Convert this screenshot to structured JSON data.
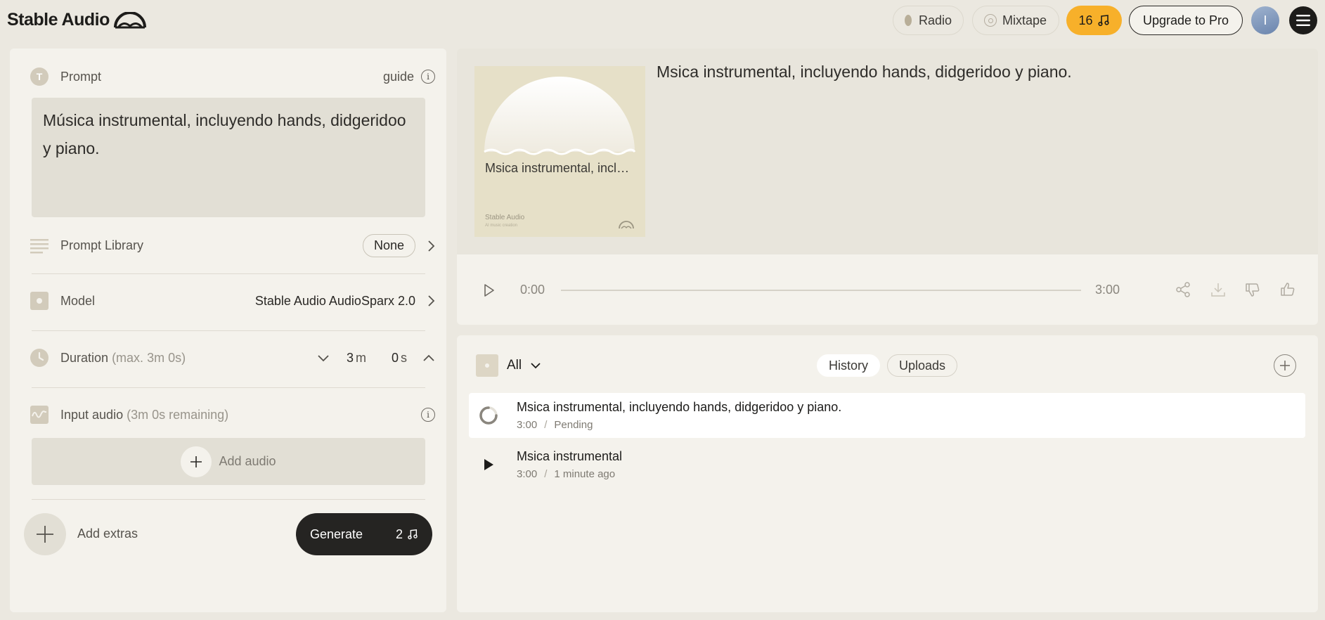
{
  "header": {
    "brand": "Stable Audio",
    "radio_label": "Radio",
    "mixtape_label": "Mixtape",
    "credits": "16",
    "upgrade_label": "Upgrade to Pro",
    "avatar_initial": "I"
  },
  "prompt_panel": {
    "prompt_label": "Prompt",
    "guide_label": "guide",
    "prompt_text": "Música instrumental, incluyendo hands, didgeridoo y piano.",
    "library_label": "Prompt Library",
    "library_value": "None",
    "model_label": "Model",
    "model_value": "Stable Audio AudioSparx 2.0",
    "duration_label": "Duration",
    "duration_hint": "(max. 3m 0s)",
    "duration_minutes": "3",
    "duration_minutes_unit": "m",
    "duration_seconds": "0",
    "duration_seconds_unit": "s",
    "input_audio_label": "Input audio",
    "input_audio_hint": "(3m 0s remaining)",
    "add_audio_label": "Add audio",
    "add_extras_label": "Add extras",
    "generate_label": "Generate",
    "generate_cost": "2"
  },
  "player": {
    "cover_title": "Msica instrumental, incluyendo hands, didgeridoo y piano.",
    "cover_brand": "Stable Audio",
    "cover_sub": "AI music creation",
    "track_title": "Msica instrumental, incluyendo hands, didgeridoo y piano.",
    "time_current": "0:00",
    "time_total": "3:00",
    "progress": 0
  },
  "library": {
    "filter_label": "All",
    "tabs": [
      {
        "label": "History",
        "active": true
      },
      {
        "label": "Uploads",
        "active": false
      }
    ],
    "tracks": [
      {
        "title": "Msica instrumental, incluyendo hands, didgeridoo y piano.",
        "duration": "3:00",
        "status": "Pending",
        "state": "loading"
      },
      {
        "title": "Msica instrumental",
        "duration": "3:00",
        "status": "1 minute ago",
        "state": "ready"
      }
    ]
  },
  "colors": {
    "background": "#ebe8e0",
    "panel": "#f4f2ec",
    "accent": "#f7b02a",
    "dark": "#252422"
  }
}
